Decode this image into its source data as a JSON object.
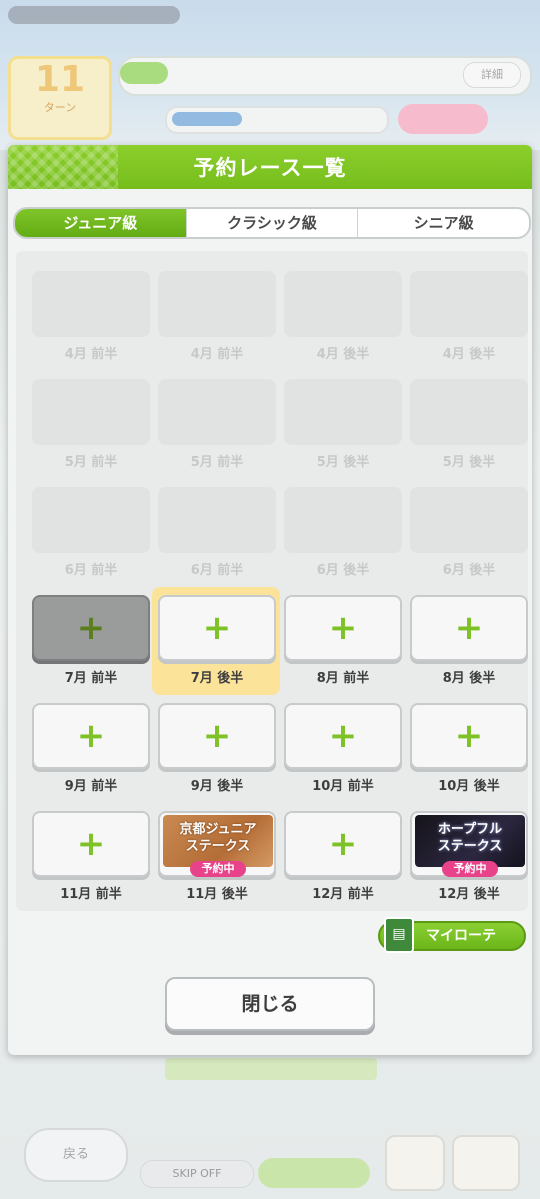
{
  "background": {
    "turn_number": "11",
    "turn_unit": "ターン",
    "detail_label": "詳細",
    "back_label": "戻る",
    "skip_label": "SKIP OFF"
  },
  "dialog": {
    "title": "予約レース一覧",
    "tabs": [
      "ジュニア級",
      "クラシック級",
      "シニア級"
    ],
    "active_tab": 0,
    "slots": [
      {
        "label": "4月 前半",
        "state": "disabled"
      },
      {
        "label": "4月 前半",
        "state": "disabled"
      },
      {
        "label": "4月 後半",
        "state": "disabled"
      },
      {
        "label": "4月 後半",
        "state": "disabled"
      },
      {
        "label": "5月 前半",
        "state": "disabled"
      },
      {
        "label": "5月 前半",
        "state": "disabled"
      },
      {
        "label": "5月 後半",
        "state": "disabled"
      },
      {
        "label": "5月 後半",
        "state": "disabled"
      },
      {
        "label": "6月 前半",
        "state": "disabled"
      },
      {
        "label": "6月 前半",
        "state": "disabled"
      },
      {
        "label": "6月 後半",
        "state": "disabled"
      },
      {
        "label": "6月 後半",
        "state": "disabled"
      },
      {
        "label": "7月 前半",
        "state": "current"
      },
      {
        "label": "7月 後半",
        "state": "selected"
      },
      {
        "label": "8月 前半",
        "state": "add"
      },
      {
        "label": "8月 後半",
        "state": "add"
      },
      {
        "label": "9月 前半",
        "state": "add"
      },
      {
        "label": "9月 後半",
        "state": "add"
      },
      {
        "label": "10月 前半",
        "state": "add"
      },
      {
        "label": "10月 後半",
        "state": "add"
      },
      {
        "label": "11月 前半",
        "state": "add"
      },
      {
        "label": "11月 後半",
        "state": "race",
        "race_name": "京都ジュニアステークス",
        "race_line1": "京都ジュニア",
        "race_line2": "ステークス",
        "race_style": "kyoto",
        "badge": "予約中"
      },
      {
        "label": "12月 前半",
        "state": "add"
      },
      {
        "label": "12月 後半",
        "state": "race",
        "race_name": "ホープフルステークス",
        "race_line1": "ホープフル",
        "race_line2": "ステークス",
        "race_style": "hope",
        "badge": "予約中"
      }
    ],
    "plus_symbol": "+",
    "my_route_label": "マイローテ",
    "close_label": "閉じる"
  }
}
